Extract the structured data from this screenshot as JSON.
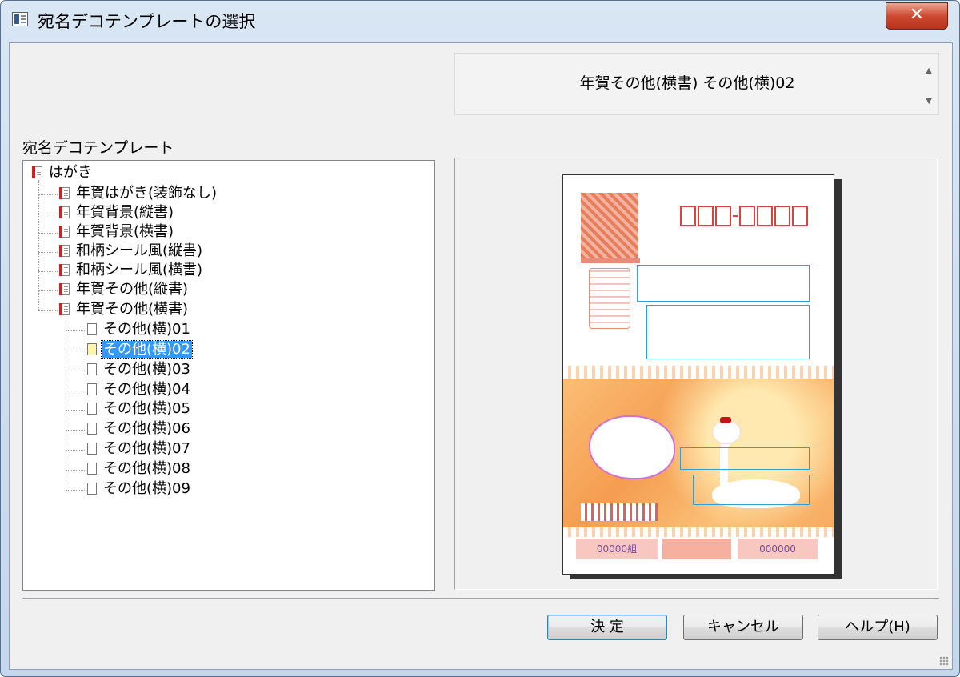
{
  "window": {
    "title": "宛名デコテンプレートの選択",
    "close_glyph": "✕"
  },
  "preview_name": "年賀その他(横書) その他(横)02",
  "tree": {
    "label": "宛名デコテンプレート",
    "root": "はがき",
    "categories": [
      "年賀はがき(装飾なし)",
      "年賀背景(縦書)",
      "年賀背景(横書)",
      "和柄シール風(縦書)",
      "和柄シール風(横書)",
      "年賀その他(縦書)",
      "年賀その他(横書)"
    ],
    "items": [
      "その他(横)01",
      "その他(横)02",
      "その他(横)03",
      "その他(横)04",
      "その他(横)05",
      "その他(横)06",
      "その他(横)07",
      "その他(横)08",
      "その他(横)09"
    ],
    "selected_item": "その他(横)02"
  },
  "card": {
    "lottery_left": "00000組",
    "lottery_right": "000000"
  },
  "buttons": {
    "ok": "決 定",
    "cancel": "キャンセル",
    "help": "ヘルプ(H)"
  }
}
